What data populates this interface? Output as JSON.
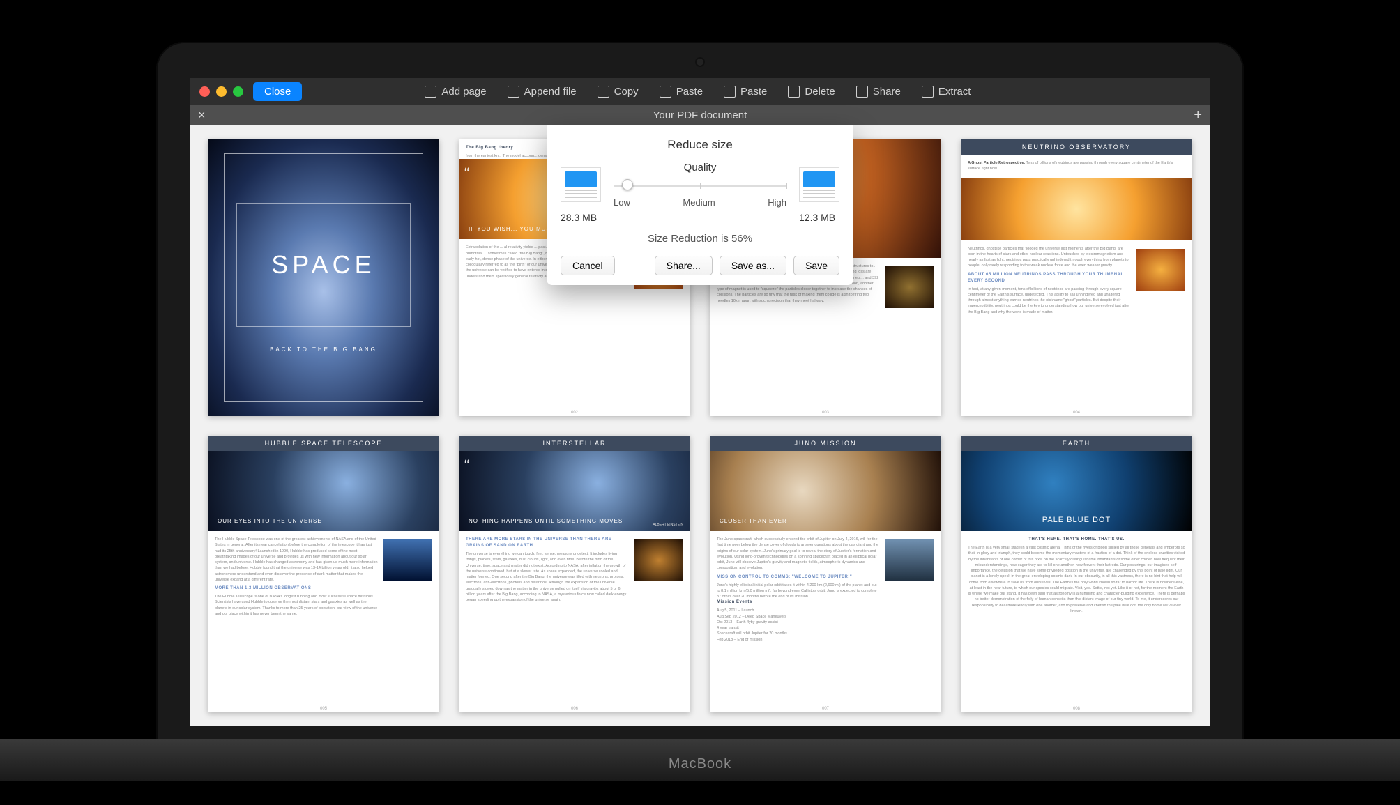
{
  "device": {
    "brand": "MacBook"
  },
  "titlebar": {
    "close": "Close",
    "buttons": {
      "add_page": "Add page",
      "append_file": "Append file",
      "copy": "Copy",
      "paste1": "Paste",
      "paste2": "Paste",
      "delete": "Delete",
      "share": "Share",
      "extract": "Extract"
    }
  },
  "subbar": {
    "close_glyph": "×",
    "title": "Your PDF document",
    "add_glyph": "+"
  },
  "dialog": {
    "title": "Reduce size",
    "quality_label": "Quality",
    "low": "Low",
    "medium": "Medium",
    "high": "High",
    "before_size": "28.3 MB",
    "after_size": "12.3 MB",
    "reduction_text": "Size Reduction is 56%",
    "cancel": "Cancel",
    "share": "Share...",
    "save_as": "Save as...",
    "save": "Save",
    "slider_position_pct": 8
  },
  "pages": {
    "cover": {
      "title": "SPACE",
      "subtitle": "BACK TO THE BIG BANG"
    },
    "p2": {
      "heading": "The Big Bang theory",
      "quote": "IF YOU WISH... YOU MUST FIRST...",
      "section": "THIS PRIMORDIAL..."
    },
    "p3": {
      "title": "",
      "caption": ""
    },
    "p4": {
      "title": "NEUTRINO OBSERVATORY",
      "lead": "A Ghost Particle Retrospective.",
      "stat": "ABOUT 65 MILLION NEUTRINOS PASS THROUGH YOUR THUMBNAIL EVERY SECOND"
    },
    "p5": {
      "title": "HUBBLE SPACE TELESCOPE",
      "caption": "OUR EYES INTO THE UNIVERSE",
      "stat": "MORE THAN 1.3 MILLION OBSERVATIONS"
    },
    "p6": {
      "title": "INTERSTELLAR",
      "caption": "NOTHING HAPPENS UNTIL SOMETHING MOVES",
      "author": "ALBERT EINSTEIN",
      "stat": "THERE ARE MORE STARS IN THE UNIVERSE THAN THERE ARE GRAINS OF SAND ON EARTH"
    },
    "p7": {
      "title": "JUNO MISSION",
      "caption": "CLOSER THAN EVER",
      "subhead": "MISSION CONTROL TO COMMS: \"WELCOME TO JUPITER!\"",
      "events": "Mission Events"
    },
    "p8": {
      "title": "EARTH",
      "caption": "PALE BLUE DOT",
      "subhead": "THAT'S HERE. THAT'S HOME. THAT'S US."
    }
  }
}
